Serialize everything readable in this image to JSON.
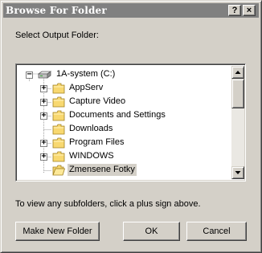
{
  "window": {
    "title": "Browse For Folder",
    "help_label": "?",
    "close_label": "×"
  },
  "prompt": "Select Output Folder:",
  "tree": {
    "items": [
      {
        "label": "1A-system (C:)",
        "icon": "drive-icon",
        "expander": "−"
      },
      {
        "label": "AppServ",
        "icon": "folder-icon",
        "expander": "+"
      },
      {
        "label": "Capture Video",
        "icon": "folder-icon",
        "expander": "+"
      },
      {
        "label": "Documents and Settings",
        "icon": "folder-icon",
        "expander": "+"
      },
      {
        "label": "Downloads",
        "icon": "folder-icon",
        "expander": ""
      },
      {
        "label": "Program Files",
        "icon": "folder-icon",
        "expander": "+"
      },
      {
        "label": "WINDOWS",
        "icon": "folder-icon",
        "expander": "+"
      },
      {
        "label": "Zmensene Fotky",
        "icon": "folder-icon",
        "expander": "",
        "selected": true
      }
    ]
  },
  "hint": "To view any subfolders, click a plus sign above.",
  "buttons": {
    "new_folder": "Make New Folder",
    "ok": "OK",
    "cancel": "Cancel"
  },
  "colors": {
    "dialog_face": "#d4d0c8",
    "titlebar": "#808080",
    "folder": "#f8d870"
  }
}
